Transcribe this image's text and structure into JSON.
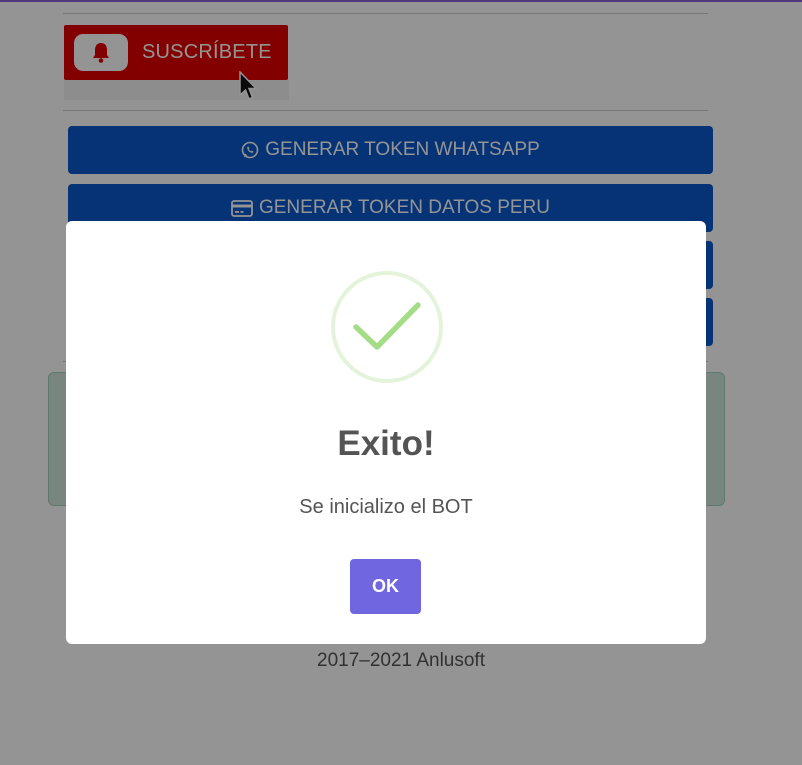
{
  "subscribe": {
    "label": "SUSCRÍBETE",
    "icon": "bell-icon",
    "cursor_icon": "mouse-cursor-icon",
    "color": "#e00000"
  },
  "buttons": [
    {
      "label": "GENERAR TOKEN WHATSAPP",
      "icon": "whatsapp-icon"
    },
    {
      "label": "GENERAR TOKEN DATOS PERU",
      "icon": "credit-card-icon"
    }
  ],
  "footer": {
    "text": "2017–2021 Anlusoft"
  },
  "modal": {
    "icon": "success-check-icon",
    "title": "Exito!",
    "message": "Se inicializo el BOT",
    "confirm_label": "OK",
    "confirm_color": "#7066e0"
  },
  "colors": {
    "primary": "#0a58ca",
    "success_icon": "#a5dc86",
    "top_accent": "#8a5fd6"
  }
}
